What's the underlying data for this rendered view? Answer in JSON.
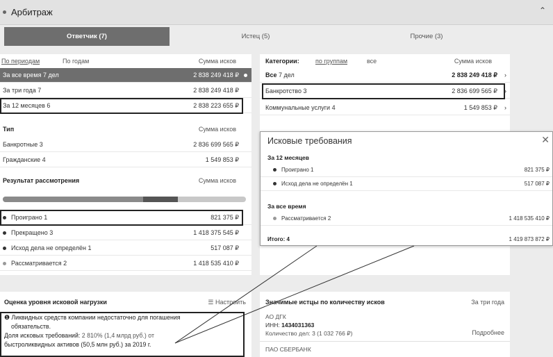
{
  "header": {
    "title": "Арбитраж"
  },
  "tabs": [
    {
      "label": "Ответчик (7)"
    },
    {
      "label": "Истец (5)"
    },
    {
      "label": "Прочие (3)"
    }
  ],
  "periods": {
    "tab_periods": "По периодам",
    "tab_years": "По годам",
    "col_sum": "Сумма исков",
    "rows": [
      {
        "label": "За все время",
        "count": "7 дел",
        "sum": "2 838 249 418 ₽"
      },
      {
        "label": "За три года",
        "count": "7",
        "sum": "2 838 249 418 ₽"
      },
      {
        "label": "За 12 месяцев",
        "count": "6",
        "sum": "2 838 223 655 ₽"
      }
    ]
  },
  "type": {
    "title": "Тип",
    "col_sum": "Сумма исков",
    "rows": [
      {
        "label": "Банкротные",
        "count": "3",
        "sum": "2 836 699 565 ₽"
      },
      {
        "label": "Гражданские",
        "count": "4",
        "sum": "1 549 853 ₽"
      }
    ]
  },
  "result": {
    "title": "Результат рассмотрения",
    "col_sum": "Сумма исков",
    "rows": [
      {
        "label": "Проиграно",
        "count": "1",
        "sum": "821 375 ₽"
      },
      {
        "label": "Прекращено",
        "count": "3",
        "sum": "1 418 375 545 ₽"
      },
      {
        "label": "Исход дела не определён",
        "count": "1",
        "sum": "517 087 ₽"
      },
      {
        "label": "Рассматривается",
        "count": "2",
        "sum": "1 418 535 410 ₽"
      }
    ]
  },
  "categories": {
    "title": "Категории:",
    "tab_groups": "по группам",
    "tab_all": "все",
    "col_sum": "Сумма исков",
    "rows": [
      {
        "label": "Все",
        "count": "7 дел",
        "sum": "2 838 249 418 ₽"
      },
      {
        "label": "Банкротство",
        "count": "3",
        "sum": "2 836 699 565 ₽"
      },
      {
        "label": "Коммунальные услуги",
        "count": "4",
        "sum": "1 549 853 ₽"
      }
    ]
  },
  "popup": {
    "title": "Исковые требования",
    "sec1": "За 12 месяцев",
    "sec1_rows": [
      {
        "label": "Проиграно",
        "count": "1",
        "sum": "821 375 ₽"
      },
      {
        "label": "Исход дела не определён",
        "count": "1",
        "sum": "517 087 ₽"
      }
    ],
    "sec2": "За все время",
    "sec2_rows": [
      {
        "label": "Рассматривается",
        "count": "2",
        "sum": "1 418 535 410 ₽"
      }
    ],
    "total_label": "Итого:",
    "total_count": "4",
    "total_sum": "1 419 873 872 ₽"
  },
  "load": {
    "title": "Оценка уровня исковой нагрузки",
    "settings": "Настроить",
    "line1": "Ликвидных средств компании недостаточно для погашения",
    "line2": "обязательств.",
    "line3a": "Доля исковых требований:",
    "line3b": "2 810% (1,4 млрд руб.) от",
    "line4": "быстроликвидных активов (50,5 млн руб.) за 2019 г."
  },
  "plaintiffs": {
    "title": "Значимые истцы по количеству исков",
    "period": "За три года",
    "items": [
      {
        "name": "АО ДГК",
        "inn_label": "ИНН:",
        "inn": "1434031363",
        "count_text": "Количество дел: 3 (1 032 766 ₽)",
        "more": "Подробнее"
      },
      {
        "name": "ПАО СБЕРБАНК"
      }
    ]
  },
  "colors": {
    "accent_gray": "#6e6e6e",
    "highlight_border": "#222222",
    "bg": "#ececec"
  }
}
